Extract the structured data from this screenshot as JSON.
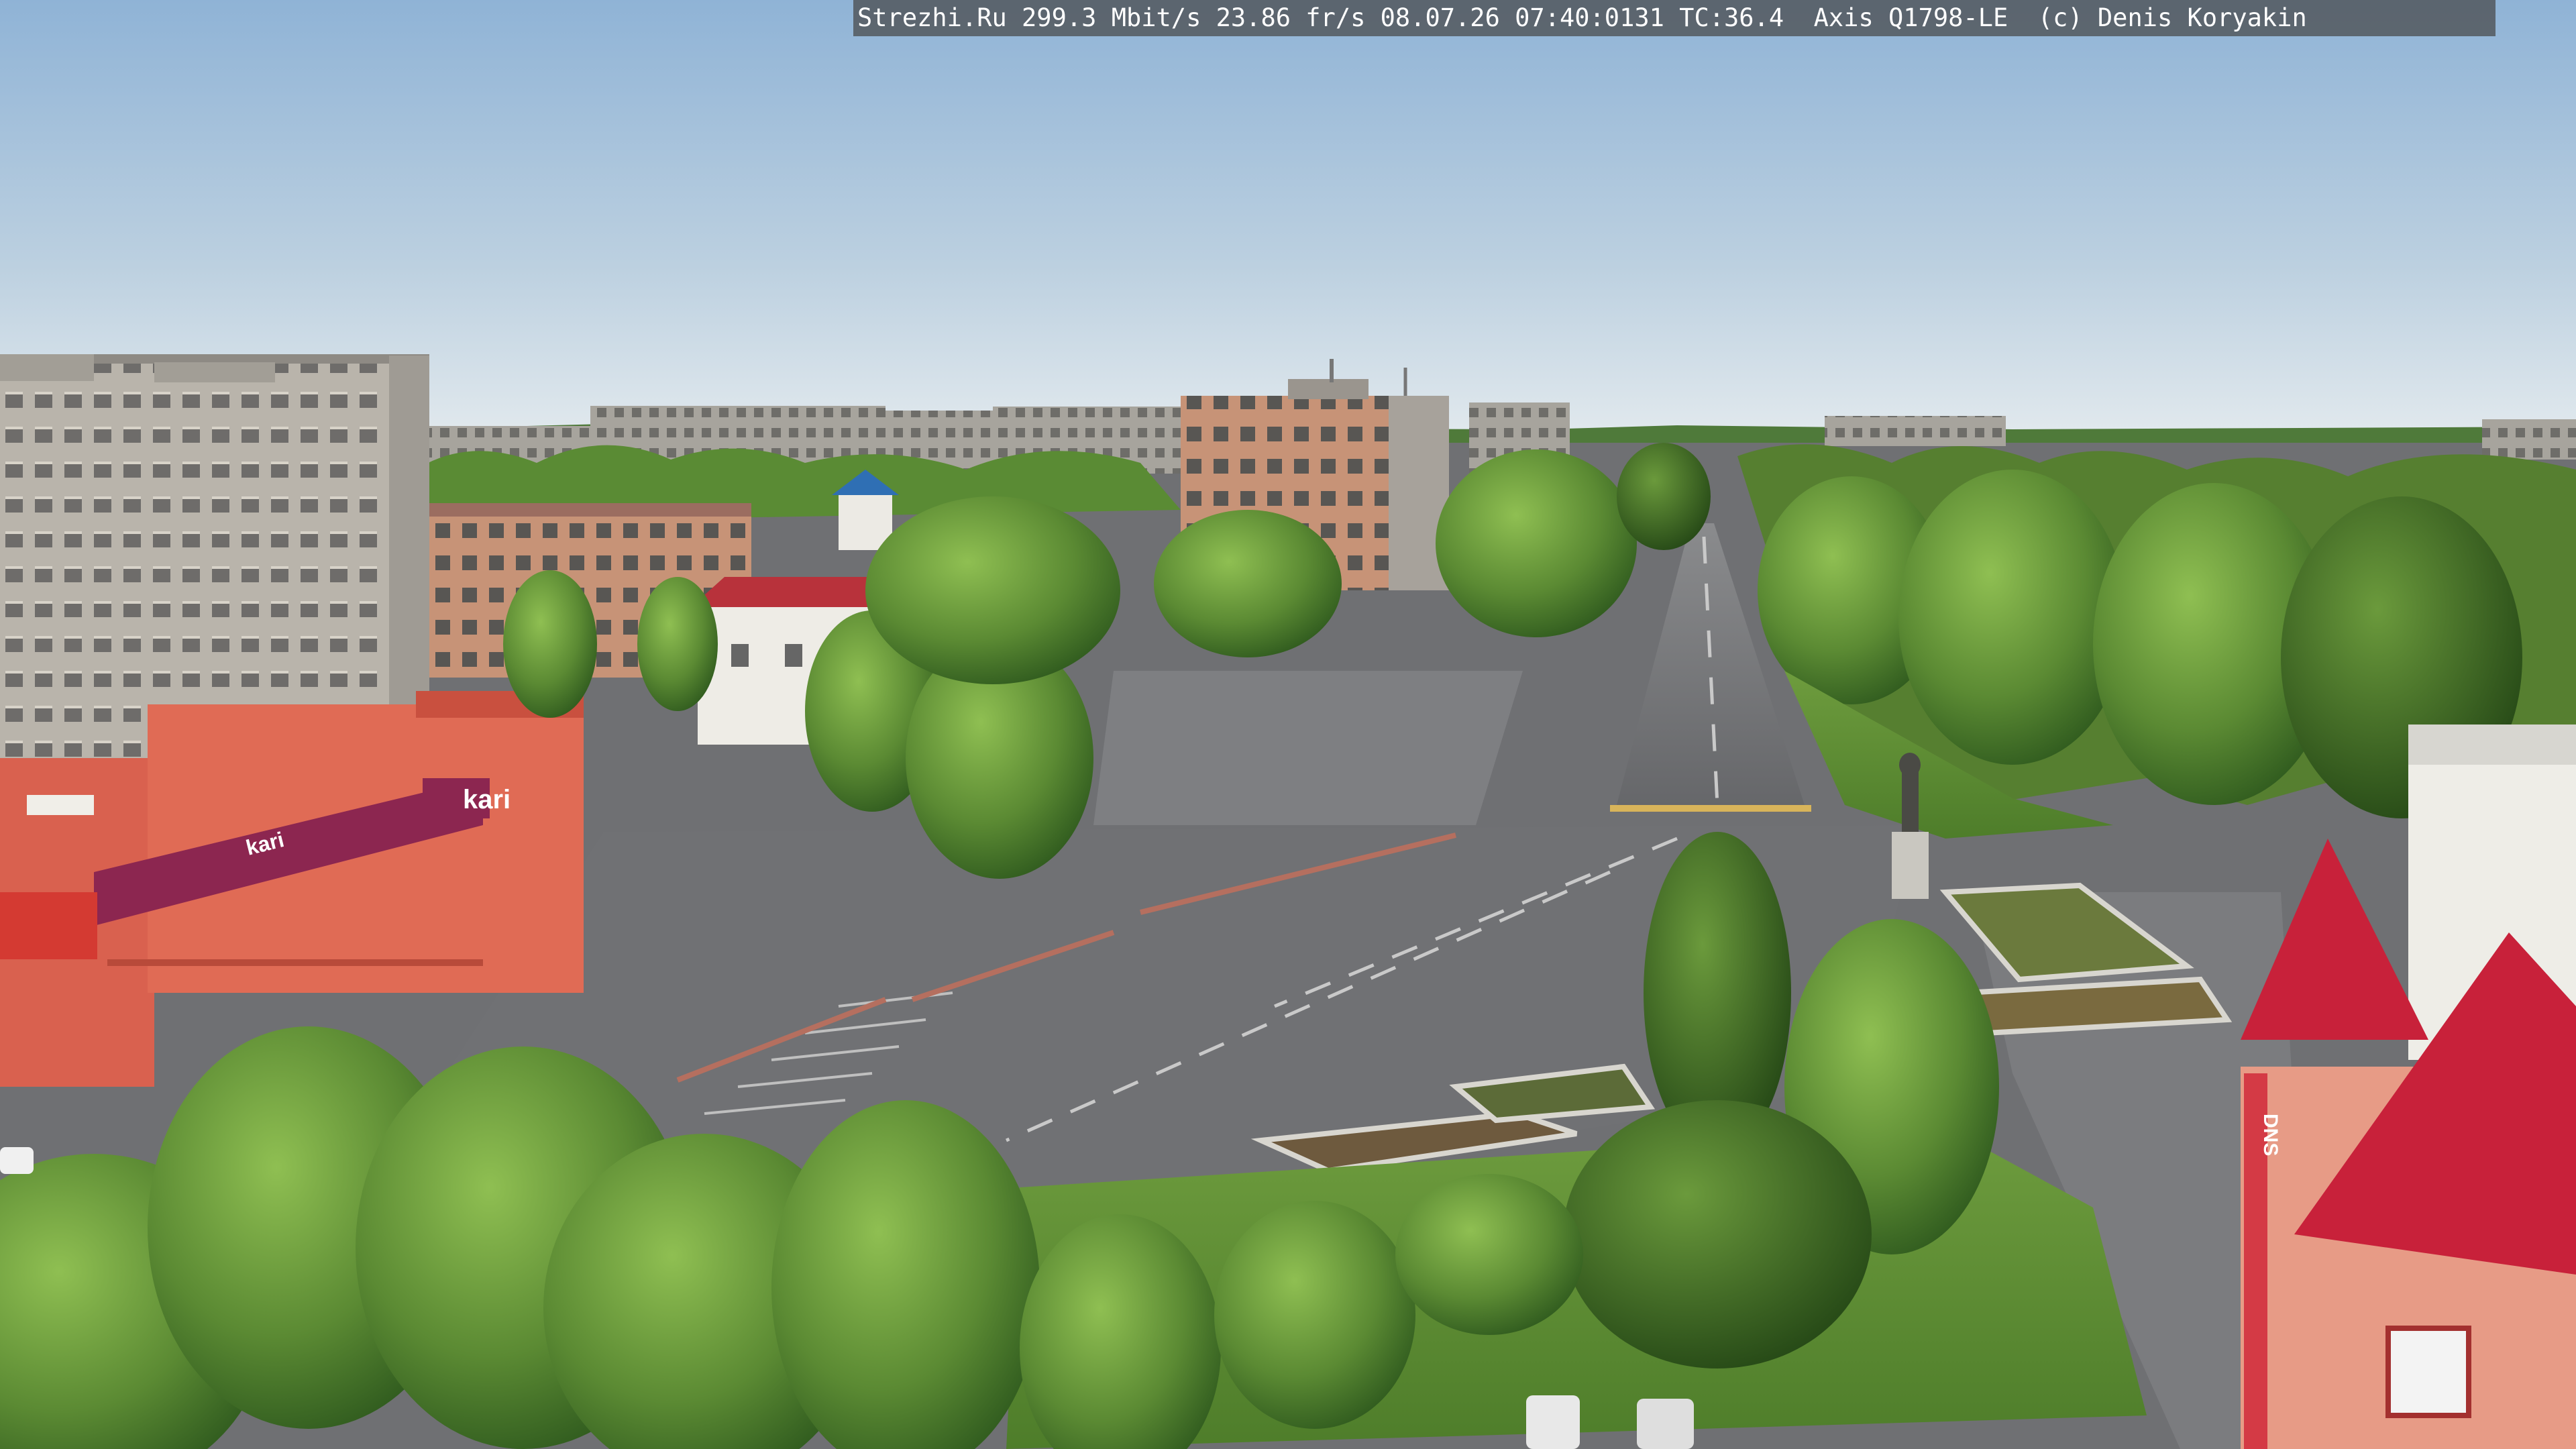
{
  "camera_overlay": {
    "text": "Strezhi.Ru 299.3 Mbit/s 23.86 fr/s 08.07.26 07:40:0131 TC:36.4  Axis Q1798-LE  (c) Denis Koryakin"
  },
  "signage": {
    "store_logo": "kari",
    "store_facade_logo": "kari",
    "electronics_store_logo": "DNS"
  },
  "colors": {
    "sky_top": "#8fb3d6",
    "sky_horizon": "#dfe8ee",
    "asphalt": "#6f7073",
    "tree_green": "#5d8a36",
    "store_red": "#d9614f",
    "kari_banner": "#8c2650",
    "roof_red": "#c8213a"
  }
}
